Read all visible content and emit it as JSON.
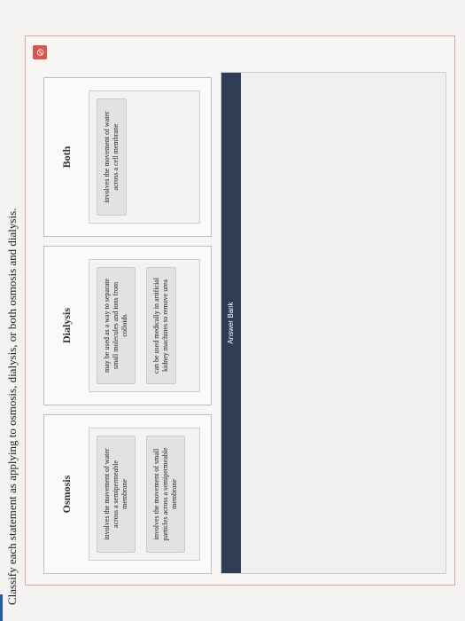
{
  "prompt": "Classify each statement as applying to osmosis, dialysis, or both osmosis and dialysis.",
  "reset_icon_glyph": "⊘",
  "columns": [
    {
      "title": "Osmosis",
      "cards": [
        "involves the movement of water across a semipermeable membrane",
        "involves the movement of small particles across a semipermeable membrane"
      ]
    },
    {
      "title": "Dialysis",
      "cards": [
        "may be used as a way to separate small molecules and ions from colloids",
        "can be used medically in artificial kidney machines to remove urea"
      ]
    },
    {
      "title": "Both",
      "cards": [
        "involves the movement of water across a cell membrane"
      ]
    }
  ],
  "answer_bank": {
    "title": "Answer Bank"
  },
  "colors": {
    "reset_button": "#d9534f",
    "answer_bank_header": "#2f3d55"
  }
}
